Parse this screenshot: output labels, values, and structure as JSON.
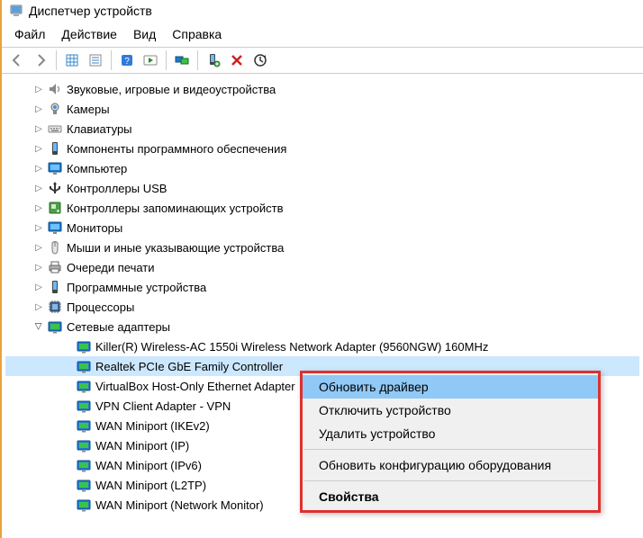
{
  "title": "Диспетчер устройств",
  "menu": {
    "file": "Файл",
    "action": "Действие",
    "view": "Вид",
    "help": "Справка"
  },
  "categories": {
    "sound": "Звуковые, игровые и видеоустройства",
    "cameras": "Камеры",
    "keyboards": "Клавиатуры",
    "software": "Компоненты программного обеспечения",
    "computer": "Компьютер",
    "usb": "Контроллеры USB",
    "storage": "Контроллеры запоминающих устройств",
    "monitors": "Мониторы",
    "mice": "Мыши и иные указывающие устройства",
    "printqueues": "Очереди печати",
    "softdev": "Программные устройства",
    "cpu": "Процессоры",
    "netadapters": "Сетевые адаптеры"
  },
  "net_devices": [
    "Killer(R) Wireless-AC 1550i Wireless Network Adapter (9560NGW) 160MHz",
    "Realtek PCIe GbE Family Controller",
    "VirtualBox Host-Only Ethernet Adapter",
    "VPN Client Adapter - VPN",
    "WAN Miniport (IKEv2)",
    "WAN Miniport (IP)",
    "WAN Miniport (IPv6)",
    "WAN Miniport (L2TP)",
    "WAN Miniport (Network Monitor)"
  ],
  "selected_net_device_index": 1,
  "context_menu": {
    "update": "Обновить драйвер",
    "disable": "Отключить устройство",
    "uninstall": "Удалить устройство",
    "scan": "Обновить конфигурацию оборудования",
    "props": "Свойства"
  }
}
